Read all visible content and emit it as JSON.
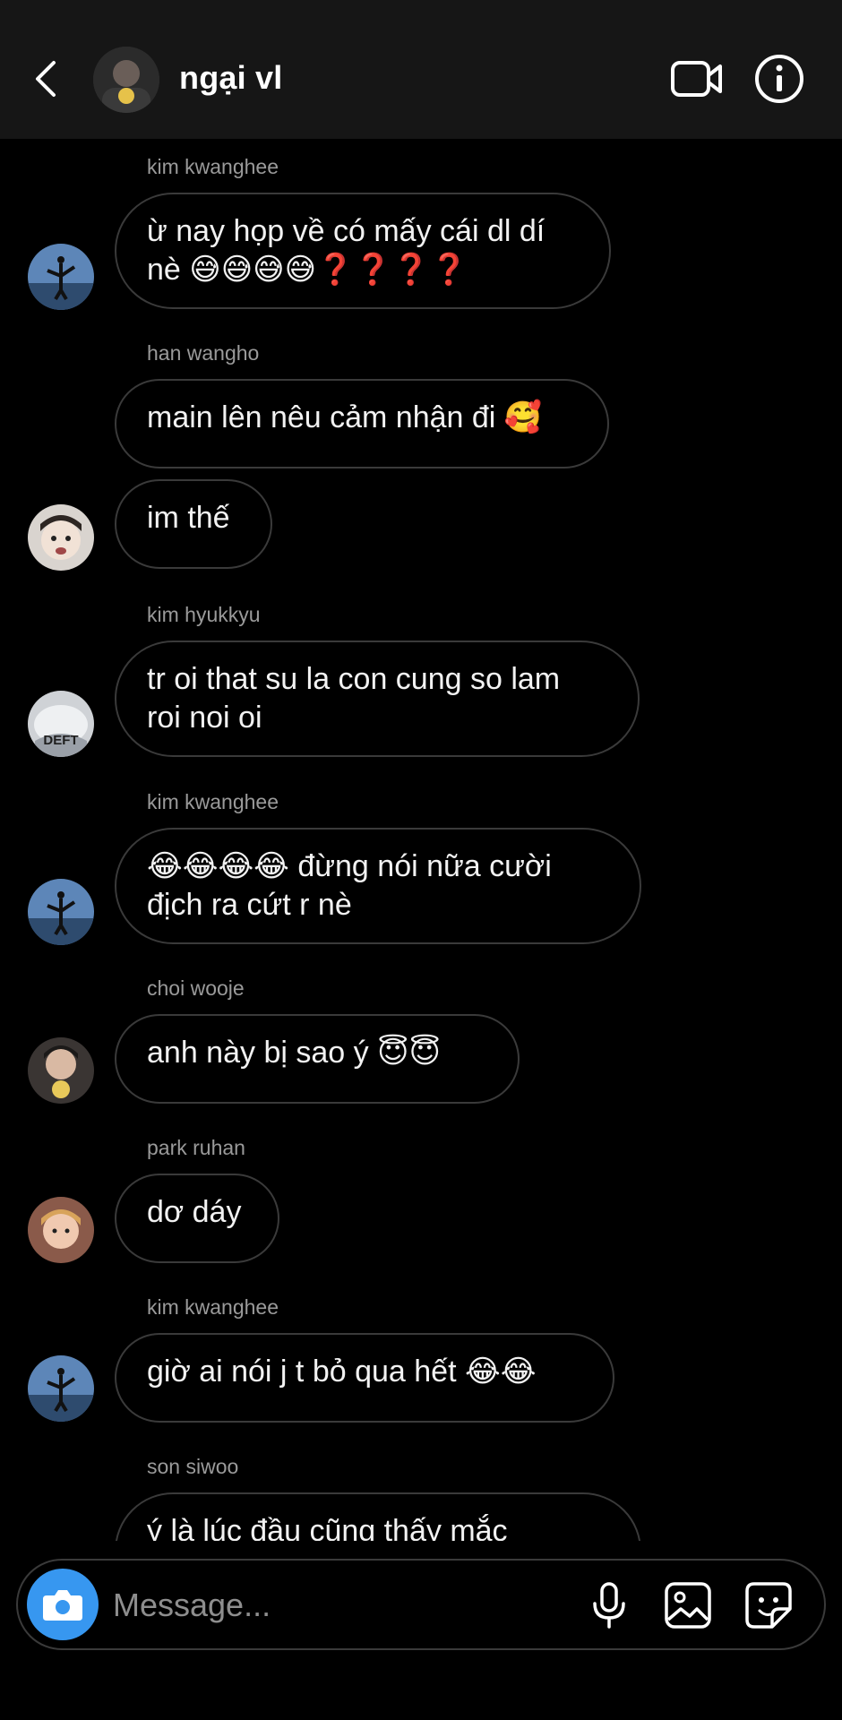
{
  "header": {
    "title": "ngại vl",
    "back_icon": "chevron-left-icon",
    "video_icon": "video-camera-icon",
    "info_icon": "info-icon"
  },
  "messages": [
    {
      "sender": "kim kwanghee",
      "lines": [
        "ừ nay họp về có mấy cái dl dí",
        "nè 😅😅😅😅❓❓❓❓"
      ]
    },
    {
      "sender": "han wangho",
      "lines": [
        "main lên nêu cảm nhận đi 🥰"
      ]
    },
    {
      "sender": "",
      "lines": [
        "im thế"
      ]
    },
    {
      "sender": "kim hyukkyu",
      "lines": [
        "tr oi that su la con cung so lam",
        "roi noi oi"
      ],
      "avatar_text": "DEFT"
    },
    {
      "sender": "kim kwanghee",
      "lines": [
        "😂😂😂😂 đừng nói nữa cười",
        "địch ra cứt r nè"
      ]
    },
    {
      "sender": "choi wooje",
      "lines": [
        "anh này bị sao ý 😇😇"
      ]
    },
    {
      "sender": "park ruhan",
      "lines": [
        "dơ dáy"
      ]
    },
    {
      "sender": "kim kwanghee",
      "lines": [
        "giờ ai nói j t bỏ qua hết 😂😂"
      ]
    },
    {
      "sender": "son siwoo",
      "lines": [
        "ý là lúc đầu cũng thấy mắc"
      ]
    }
  ],
  "composer": {
    "placeholder": "Message...",
    "camera_icon": "camera-icon",
    "mic_icon": "microphone-icon",
    "gallery_icon": "image-gallery-icon",
    "sticker_icon": "sticker-icon"
  },
  "colors": {
    "background": "#000000",
    "header_background": "#161616",
    "bubble_border": "#3a3a3a",
    "sender_text": "#9a9a9a",
    "camera_button": "#3797f0"
  }
}
